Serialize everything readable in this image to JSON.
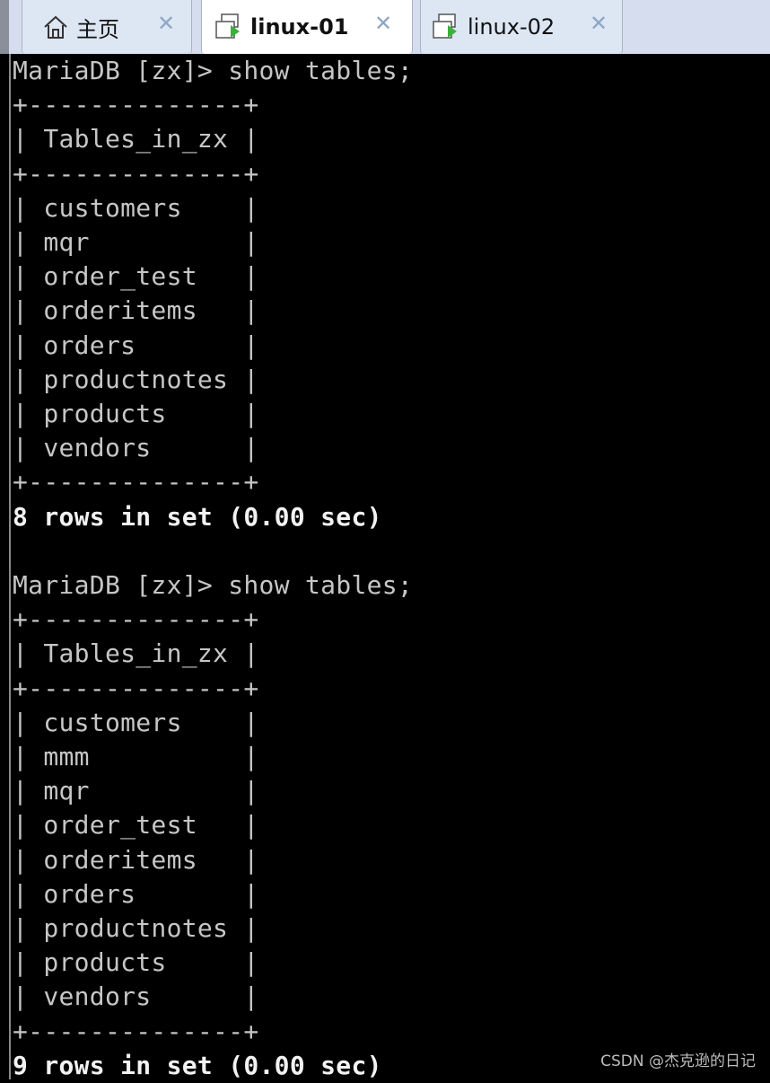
{
  "tabs": [
    {
      "label": "主页",
      "icon": "home-icon",
      "active": false
    },
    {
      "label": "linux-01",
      "icon": "vm-icon",
      "active": true
    },
    {
      "label": "linux-02",
      "icon": "vm-icon",
      "active": false
    }
  ],
  "terminal": {
    "lines": [
      "MariaDB [zx]> show tables;",
      "+--------------+",
      "| Tables_in_zx |",
      "+--------------+",
      "| customers    |",
      "| mqr          |",
      "| order_test   |",
      "| orderitems   |",
      "| orders       |",
      "| productnotes |",
      "| products     |",
      "| vendors      |",
      "+--------------+",
      "8 rows in set (0.00 sec)",
      "",
      "MariaDB [zx]> show tables;",
      "+--------------+",
      "| Tables_in_zx |",
      "+--------------+",
      "| customers    |",
      "| mmm          |",
      "| mqr          |",
      "| order_test   |",
      "| orderitems   |",
      "| orders       |",
      "| productnotes |",
      "| products     |",
      "| vendors      |",
      "+--------------+",
      "9 rows in set (0.00 sec)"
    ]
  },
  "watermark": "CSDN @杰克逊的日记"
}
